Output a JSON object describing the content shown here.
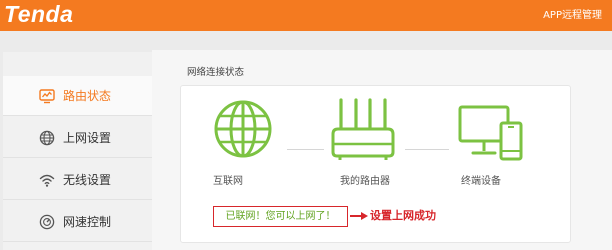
{
  "header": {
    "logo": "Tenda",
    "remote_link": "APP远程管理"
  },
  "colors": {
    "brand_orange": "#f47a20",
    "connected_green": "#7cc242",
    "annotation_red": "#d7262b"
  },
  "sidebar": {
    "items": [
      {
        "label": "路由状态",
        "icon": "monitor-chart-icon",
        "active": true
      },
      {
        "label": "上网设置",
        "icon": "globe-icon",
        "active": false
      },
      {
        "label": "无线设置",
        "icon": "wifi-icon",
        "active": false
      },
      {
        "label": "网速控制",
        "icon": "speedometer-icon",
        "active": false
      }
    ]
  },
  "status": {
    "title": "网络连接状态",
    "devices": [
      {
        "label": "互联网",
        "icon": "globe-icon"
      },
      {
        "label": "我的路由器",
        "icon": "router-icon"
      },
      {
        "label": "终端设备",
        "icon": "devices-icon"
      }
    ],
    "message": "已联网！您可以上网了！",
    "annotation": "设置上网成功"
  }
}
